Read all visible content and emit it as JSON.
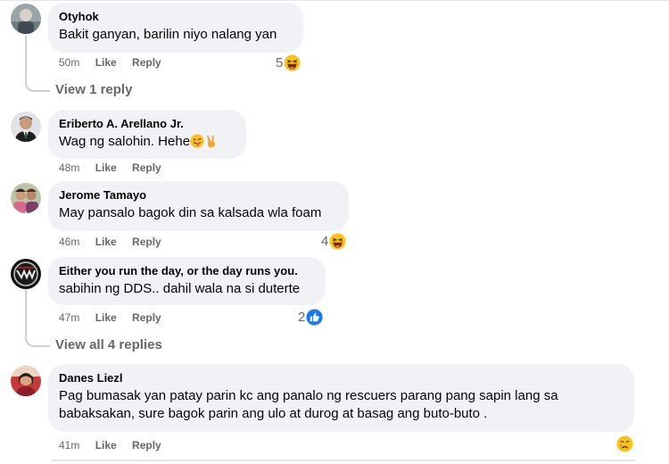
{
  "comments": [
    {
      "author": "Otyhok",
      "text": "Bakit ganyan, barilin niyo nalang yan",
      "time": "50m",
      "like": "Like",
      "reply": "Reply",
      "reaction_count": "5",
      "reaction_icon": "haha-emoji-icon",
      "view_replies": "View 1 reply"
    },
    {
      "author": "Eriberto A. Arellano Jr.",
      "text": "Wag ng salohin. Hehe",
      "time": "48m",
      "like": "Like",
      "reply": "Reply"
    },
    {
      "author": "Jerome Tamayo",
      "text": "May pansalo bagok din sa kalsada wla foam",
      "time": "46m",
      "like": "Like",
      "reply": "Reply",
      "reaction_count": "4",
      "reaction_icon": "haha-emoji-icon"
    },
    {
      "author": "Either you run the day, or the day runs you.",
      "text": "sabihin ng DDS.. dahil wala na si duterte",
      "time": "47m",
      "like": "Like",
      "reply": "Reply",
      "reaction_count": "2",
      "reaction_icon": "like-reaction-icon",
      "view_replies": "View all 4 replies"
    },
    {
      "author": "Danes Liezl",
      "text_line1": "Pag bumasak yan patay parin kc ang panalo ng rescuers parang pang sapin lang sa",
      "text_line2": "babaksakan, sure bagok parin ang ulo at durog at basag ang buto-buto .",
      "time": "41m",
      "like": "Like",
      "reply": "Reply",
      "reaction_icon": "crying-emoji-icon"
    }
  ],
  "colors": {
    "bubble": "#f0f2f5",
    "meta": "#65676b",
    "like_blue": "#1877f2",
    "emoji_yellow": "#fcc21b"
  }
}
